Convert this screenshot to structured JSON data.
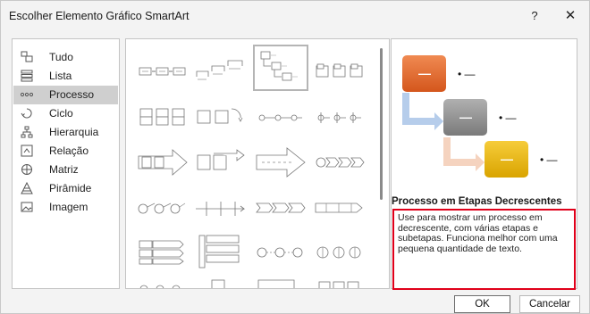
{
  "window": {
    "title": "Escolher Elemento Gráfico SmartArt",
    "help_label": "?",
    "close_label": "✕"
  },
  "categories": [
    {
      "label": "Tudo",
      "icon": "all-icon"
    },
    {
      "label": "Lista",
      "icon": "list-icon"
    },
    {
      "label": "Processo",
      "icon": "process-icon",
      "selected": true
    },
    {
      "label": "Ciclo",
      "icon": "cycle-icon"
    },
    {
      "label": "Hierarquia",
      "icon": "hierarchy-icon"
    },
    {
      "label": "Relação",
      "icon": "relationship-icon"
    },
    {
      "label": "Matriz",
      "icon": "matrix-icon"
    },
    {
      "label": "Pirâmide",
      "icon": "pyramid-icon"
    },
    {
      "label": "Imagem",
      "icon": "picture-icon"
    }
  ],
  "preview": {
    "title": "Processo em Etapas Decrescentes",
    "description": "Use para mostrar um processo em decrescente, com várias etapas e subetapas. Funciona melhor com uma pequena quantidade de texto.",
    "shape_text": "—",
    "bullet_text": "• —",
    "colors": {
      "step1": "#e0672b",
      "step2": "#8f8f8f",
      "step3": "#e8b400",
      "arrow1": "#a9c4e8",
      "arrow2": "#f3cbb4"
    }
  },
  "buttons": {
    "ok": "OK",
    "cancel": "Cancelar"
  }
}
